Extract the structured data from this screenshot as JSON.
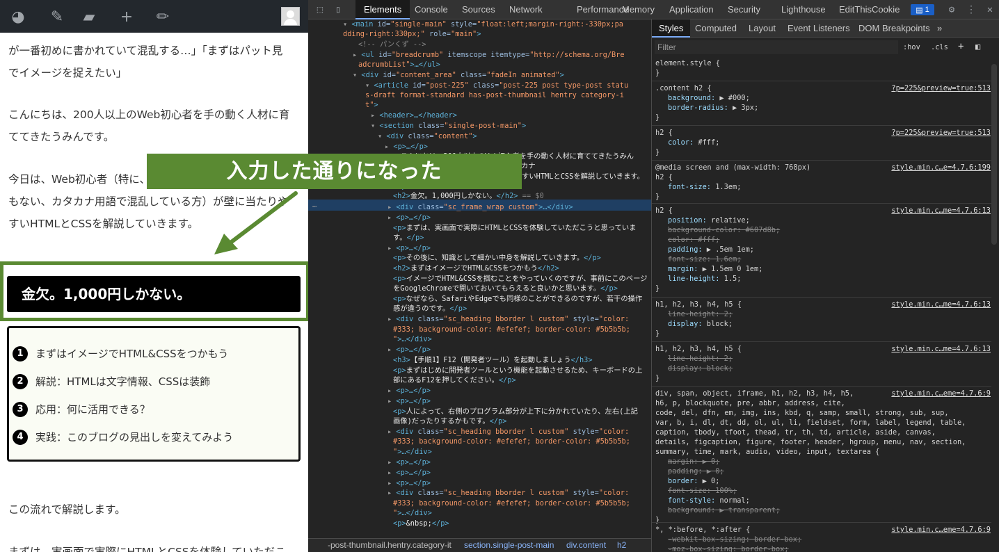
{
  "admin_bar": {
    "icons": [
      "dashboard-icon",
      "customize-brush-icon",
      "comments-icon",
      "new-content-icon",
      "edit-icon",
      "avatar"
    ]
  },
  "article": {
    "lines": [
      "が一番初めに書かれていて混乱する…」「まずはパット見",
      "でイメージを捉えたい」",
      "こんにちは、200人以上のWeb初心者を手の動く人材に育",
      "ててきたうみんです。",
      "今日は、Web初心者（特に、",
      "もない、カタカナ用語で混乱している方）が壁に当たりや",
      "すいHTMLとCSSを解説していきます。"
    ],
    "h2": "金欠。1,000円しかない。",
    "toc": [
      "まずはイメージでHTML&CSSをつかもう",
      "解説：HTMLは文字情報、CSSは装飾",
      "応用：何に活用できる？",
      "実践：このブログの見出しを変えてみよう"
    ],
    "after": "この流れで解説します。",
    "bottom": "まずは、実画面で実際にHTMLとCSSを体験していただこ"
  },
  "annotation": {
    "banner": "入力した通りになった"
  },
  "devtools": {
    "tabs": [
      "Elements",
      "Console",
      "Sources",
      "Network",
      "Performance",
      "Memory",
      "Application",
      "Security",
      "Lighthouse",
      "EditThisCookie"
    ],
    "issues_badge": "1",
    "elements": [
      [
        "<main ",
        "id=",
        "\"single-main\"",
        " style=",
        "\"float:left;margin-right:-330px;pa"
      ],
      [
        "dding-right:330px;\"",
        " role=",
        "\"main\"",
        ">"
      ],
      [
        "<!-- パンくず -->"
      ],
      [
        "<ul ",
        "id=",
        "\"breadcrumb\"",
        " itemscope itemtype=",
        "\"http://schema.org/Bre"
      ],
      [
        "adcrumbList\"",
        ">…</ul>"
      ],
      [
        "<div ",
        "id=",
        "\"content_area\"",
        " class=",
        "\"fadeIn animated\"",
        ">"
      ],
      [
        "<article ",
        "id=",
        "\"post-225\"",
        " class=",
        "\"post-225 post type-post statu"
      ],
      [
        "s-draft format-standard has-post-thumbnail hentry category-i"
      ],
      [
        "t\"",
        ">"
      ],
      [
        "<header>…</header>"
      ],
      [
        "<section ",
        "class=",
        "\"single-post-main\"",
        ">"
      ],
      [
        "<div ",
        "class=",
        "\"content\"",
        ">"
      ],
      [
        "<p>…</p>"
      ],
      [
        "<p>",
        "こんにちは、200人以上のWeb初心者を手の動く人材に育ててきたうみん"
      ],
      [
        "です。",
        "現場に配属されて間もない、カタカナ"
      ],
      [
        "用語で混乱している方）が壁に当たりやすいHTMLとCSSを解説していきます。"
      ],
      [
        "</p>"
      ],
      [
        "<h2>",
        "金欠。1,000円しかない。",
        "</h2>",
        " == $0"
      ],
      [
        "<div ",
        "class=",
        "\"sc_frame_wrap  custom\"",
        ">…</div>"
      ],
      [
        "<p>…</p>"
      ],
      [
        "<p>",
        "まずは、実画面で実際にHTMLとCSSを体験していただこうと思っていま"
      ],
      [
        "す。",
        "</p>"
      ],
      [
        "<p>…</p>"
      ],
      [
        "<p>",
        "その後に、知識として細かい中身を解説していきます。",
        "</p>"
      ],
      [
        "<h2>",
        "まずはイメージでHTML&CSSをつかもう",
        "</h2>"
      ],
      [
        "<p>",
        "イメージでHTML&CSSを掴むことをやっていくのですが、事前にこのページ"
      ],
      [
        "をGoogleChromeで開いておいてもらえると良いかと思います。",
        "</p>"
      ],
      [
        "<p>",
        "なぜなら、SafariやEdgeでも同様のことができるのですが、若干の操作"
      ],
      [
        "感が違うのです。",
        "</p>"
      ],
      [
        "<div ",
        "class=",
        "\"sc_heading bborder l custom\"",
        " style=",
        "\"color:"
      ],
      [
        "#333; background-color: #efefef; border-color: #5b5b5b;"
      ],
      [
        "\"",
        ">…</div>"
      ],
      [
        "<p>…</p>"
      ],
      [
        "<h3>",
        "【手順1】F12（開発者ツール）を起動しましょう",
        "</h3>"
      ],
      [
        "<p>",
        "まずはじめに開発者ツールという機能を起動させるため、キーボードの上"
      ],
      [
        "部にあるF12を押してください。",
        "</p>"
      ],
      [
        "<p>…</p>"
      ],
      [
        "<p>…</p>"
      ],
      [
        "<p>",
        "人によって、右側のプログラム部分が上下に分かれていたり、左右(上記"
      ],
      [
        "画像)だったりするかもです。",
        "</p>"
      ],
      [
        "<div ",
        "class=",
        "\"sc_heading bborder l custom\"",
        " style=",
        "\"color:"
      ],
      [
        "#333; background-color: #efefef; border-color: #5b5b5b;"
      ],
      [
        "\"",
        ">…</div>"
      ],
      [
        "<p>…</p>"
      ],
      [
        "<p>…</p>"
      ],
      [
        "<p>…</p>"
      ],
      [
        "<div ",
        "class=",
        "\"sc_heading bborder l custom\"",
        " style=",
        "\"color:"
      ],
      [
        "#333; background-color: #efefef; border-color: #5b5b5b;"
      ],
      [
        "\"",
        ">…</div>"
      ],
      [
        "<p>",
        "&nbsp;",
        "</p>"
      ]
    ],
    "breadcrumbs": [
      "-post-thumbnail.hentry.category-it",
      "section.single-post-main",
      "div.content",
      "h2"
    ],
    "styles_tabs": [
      "Styles",
      "Computed",
      "Layout",
      "Event Listeners",
      "DOM Breakpoints",
      "»"
    ],
    "filter_placeholder": "Filter",
    "hov": ":hov",
    "cls": ".cls",
    "rules": [
      {
        "selector": "element.style {",
        "lines": [
          "}"
        ]
      },
      {
        "selector": ".content h2 {",
        "link": "?p=225&preview=true:513",
        "lines": [
          "background: ▶ #000;",
          "border-radius: ▶ 3px;",
          "}"
        ]
      },
      {
        "selector": "h2 {",
        "link": "?p=225&preview=true:513",
        "lines": [
          "color: #fff;",
          "}"
        ]
      },
      {
        "selector": "@media screen and (max-width: 768px)",
        "lines": [
          "h2 {",
          "font-size: 1.3em;",
          "}"
        ],
        "link": "style.min.c…e=4.7.6:199"
      },
      {
        "selector": "h2 {",
        "link": "style.min.c…me=4.7.6:13",
        "lines": [
          "position: relative;",
          "background-color: #607d8b;",
          "color: #fff;",
          "padding: ▶ .5em 1em;",
          "font-size: 1.6em;",
          "margin: ▶ 1.5em 0 1em;",
          "line-height: 1.5;",
          "}"
        ]
      },
      {
        "selector": "h1, h2, h3, h4, h5 {",
        "link": "style.min.c…me=4.7.6:13",
        "lines": [
          "line-height: 2;",
          "display: block;",
          "}"
        ]
      },
      {
        "selector": "h1, h2, h3, h4, h5 {",
        "link": "style.min.c…me=4.7.6:13",
        "lines": [
          "line-height: 2;",
          "display: block;",
          "}"
        ]
      },
      {
        "selector": "div, span, object, iframe, h1, h2, h3, h4, h5,",
        "link": "style.min.c…eme=4.7.6:9",
        "lines": [
          "h6, p, blockquote, pre, abbr, address, cite,",
          "code, del, dfn, em, img, ins, kbd, q, samp, small, strong, sub, sup,",
          "var, b, i, dl, dt, dd, ol, ul, li, fieldset, form, label, legend, table,",
          "caption, tbody, tfoot, thead, tr, th, td, article, aside, canvas,",
          "details, figcaption, figure, footer, header, hgroup, menu, nav, section,",
          "summary, time, mark, audio, video, input, textarea {",
          "margin: ▶ 0;",
          "padding: ▶ 0;",
          "border: ▶ 0;",
          "font-size: 100%;",
          "font-style: normal;",
          "background: ▶ transparent;",
          "}"
        ]
      },
      {
        "selector": "*, *:before, *:after {",
        "link": "style.min.c…eme=4.7.6:9",
        "lines": [
          "-webkit-box-sizing: border-box;",
          "-moz-box-sizing: border-box;"
        ]
      }
    ]
  },
  "colors": {
    "accent": "#5a8a32",
    "devtools_bg": "#242424",
    "selection": "#1f3f63"
  }
}
